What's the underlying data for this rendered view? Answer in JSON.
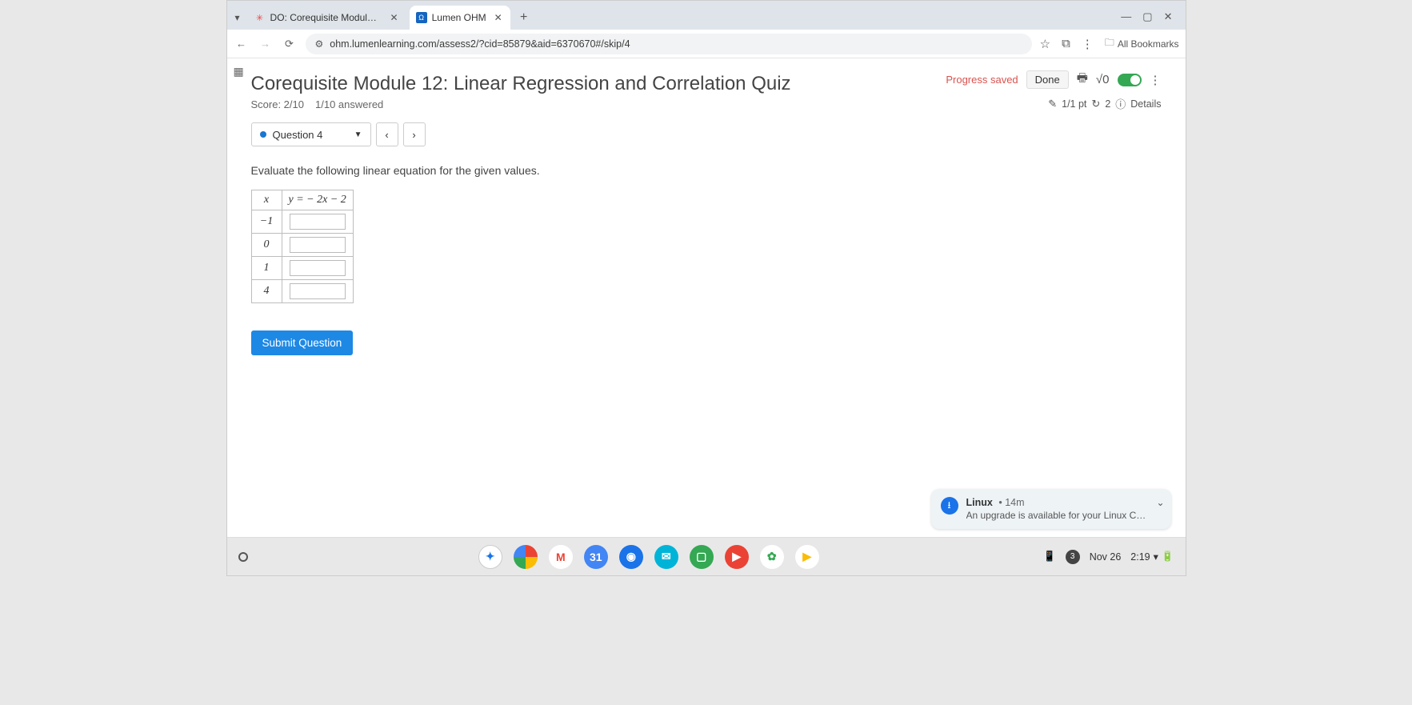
{
  "tabs": {
    "tab1": {
      "title": "DO: Corequisite Module 12: Q."
    },
    "tab2": {
      "title": "Lumen OHM"
    }
  },
  "addressbar": {
    "url": "ohm.lumenlearning.com/assess2/?cid=85879&aid=6370670#/skip/4",
    "all_bookmarks": "All Bookmarks"
  },
  "page": {
    "title": "Corequisite Module 12: Linear Regression and Correlation Quiz",
    "score_label": "Score: 2/10",
    "answered_label": "1/10 answered",
    "progress_saved": "Progress saved",
    "done": "Done",
    "points": "1/1 pt",
    "attempts": "2",
    "details": "Details",
    "question_selector": "Question 4",
    "prompt": "Evaluate the following linear equation for the given values.",
    "table": {
      "x_header": "x",
      "y_header": "y = − 2x − 2",
      "rows": [
        "−1",
        "0",
        "1",
        "4"
      ]
    },
    "submit": "Submit Question"
  },
  "toast": {
    "title": "Linux",
    "age": "14m",
    "body": "An upgrade is available for your Linux Conta..."
  },
  "shelf": {
    "date": "Nov 26",
    "time": "2:19",
    "notif_count": "3"
  }
}
